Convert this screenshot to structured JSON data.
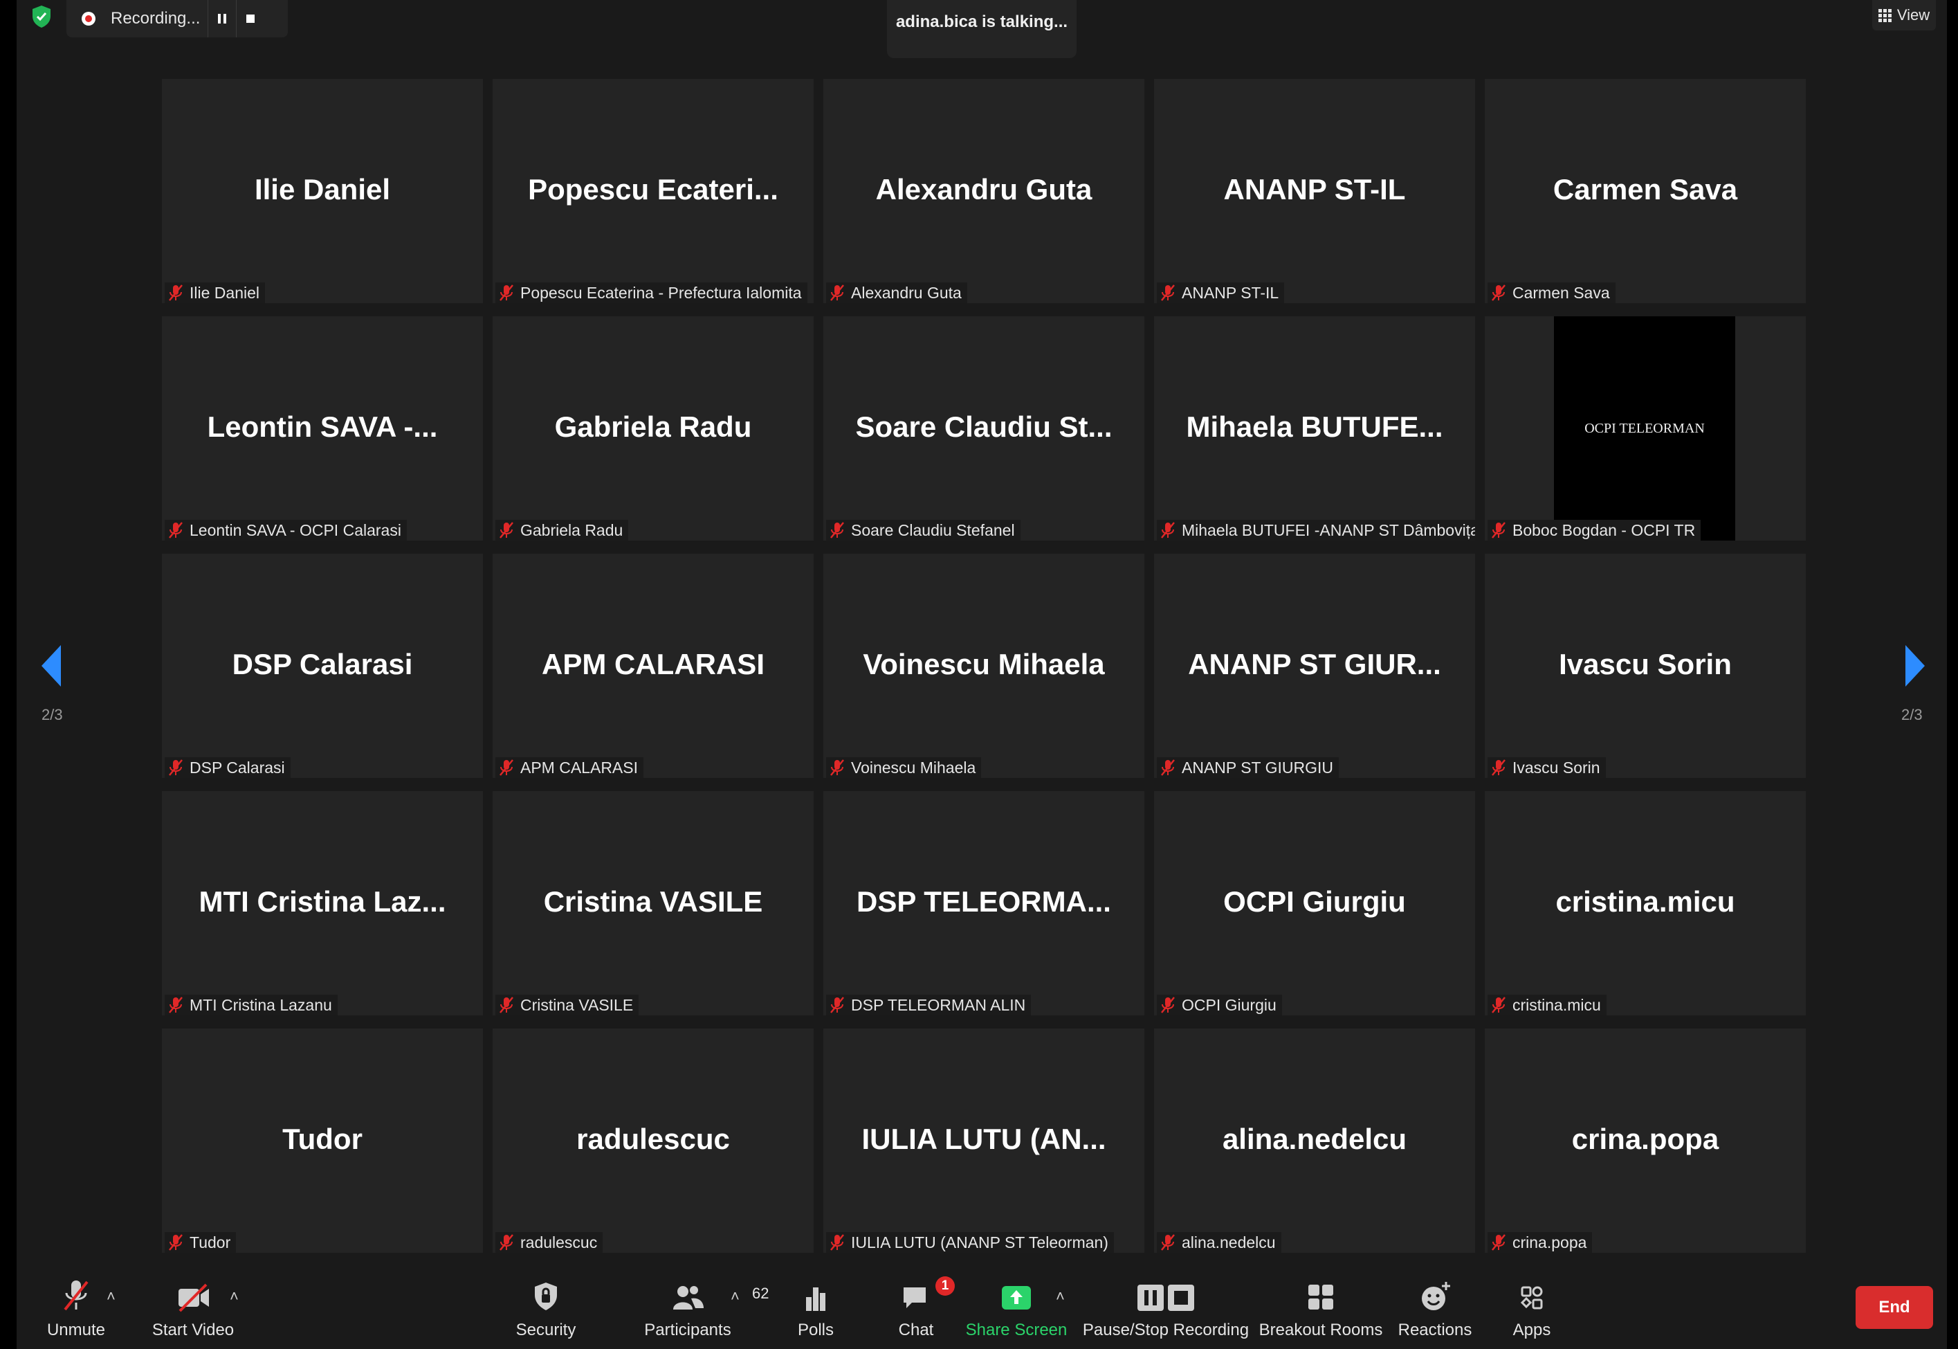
{
  "top_bar": {
    "recording_text": "Recording...",
    "talking_text": "adina.bica is talking...",
    "view_label": "View"
  },
  "page_indicator": "2/3",
  "tiles": [
    {
      "name": "Ilie Daniel",
      "label": "Ilie Daniel"
    },
    {
      "name": "Popescu  Ecateri...",
      "label": "Popescu Ecaterina - Prefectura Ialomita"
    },
    {
      "name": "Alexandru Guta",
      "label": "Alexandru Guta"
    },
    {
      "name": "ANANP ST-IL",
      "label": "ANANP ST-IL"
    },
    {
      "name": "Carmen Sava",
      "label": "Carmen Sava"
    },
    {
      "name": "Leontin SAVA -...",
      "label": "Leontin SAVA - OCPI Calarasi"
    },
    {
      "name": "Gabriela Radu",
      "label": "Gabriela Radu"
    },
    {
      "name": "Soare Claudiu St...",
      "label": "Soare Claudiu Stefanel"
    },
    {
      "name": "Mihaela  BUTUFE...",
      "label": "Mihaela BUTUFEI -ANANP ST Dâmbovița"
    },
    {
      "name": "",
      "label": "Boboc Bogdan - OCPI TR",
      "video_text": "OCPI TELEORMAN"
    },
    {
      "name": "DSP Calarasi",
      "label": "DSP Calarasi"
    },
    {
      "name": "APM CALARASI",
      "label": "APM CALARASI"
    },
    {
      "name": "Voinescu Mihaela",
      "label": "Voinescu Mihaela"
    },
    {
      "name": "ANANP ST GIUR...",
      "label": "ANANP ST GIURGIU"
    },
    {
      "name": "Ivascu Sorin",
      "label": "Ivascu Sorin"
    },
    {
      "name": "MTI Cristina Laz...",
      "label": "MTI Cristina Lazanu"
    },
    {
      "name": "Cristina VASILE",
      "label": "Cristina VASILE"
    },
    {
      "name": "DSP  TELEORMA...",
      "label": "DSP TELEORMAN ALIN"
    },
    {
      "name": "OCPI Giurgiu",
      "label": "OCPI Giurgiu"
    },
    {
      "name": "cristina.micu",
      "label": "cristina.micu"
    },
    {
      "name": "Tudor",
      "label": "Tudor"
    },
    {
      "name": "radulescuc",
      "label": "radulescuc"
    },
    {
      "name": "IULIA  LUTU  (AN...",
      "label": "IULIA LUTU (ANANP ST Teleorman)"
    },
    {
      "name": "alina.nedelcu",
      "label": "alina.nedelcu"
    },
    {
      "name": "crina.popa",
      "label": "crina.popa"
    }
  ],
  "toolbar": {
    "unmute": "Unmute",
    "start_video": "Start Video",
    "security": "Security",
    "participants": "Participants",
    "participants_count": "62",
    "polls": "Polls",
    "chat": "Chat",
    "chat_badge": "1",
    "share_screen": "Share Screen",
    "pause_stop_recording": "Pause/Stop Recording",
    "breakout_rooms": "Breakout Rooms",
    "reactions": "Reactions",
    "apps": "Apps",
    "end": "End"
  },
  "colors": {
    "background": "#1a1a1a",
    "tile": "#242424",
    "mute_red": "#e02828",
    "share_green": "#2bd36a",
    "end_red": "#d92d2d",
    "nav_blue": "#2d8cff"
  }
}
